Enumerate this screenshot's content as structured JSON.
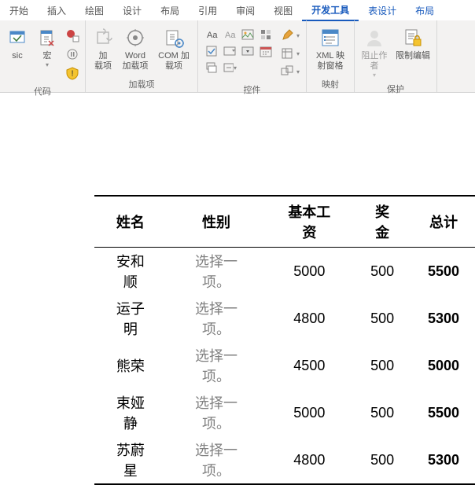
{
  "tabs": {
    "start": "开始",
    "insert": "插入",
    "draw": "绘图",
    "design": "设计",
    "layout": "布局",
    "ref": "引用",
    "review": "审阅",
    "view": "视图",
    "dev": "开发工具",
    "tdesign": "表设计",
    "tlayout": "布局"
  },
  "ribbon": {
    "code": {
      "basic": "sic",
      "macro": "宏",
      "label": "代码"
    },
    "addins": {
      "addin": "加\n载项",
      "word": "Word\n加载项",
      "com": "COM 加载项",
      "label": "加载项"
    },
    "controls": {
      "label": "控件"
    },
    "mapping": {
      "xml": "XML 映\n射窗格",
      "label": "映射"
    },
    "protect": {
      "block": "阻止作者",
      "restrict": "限制编辑",
      "label": "保护"
    }
  },
  "table": {
    "headers": {
      "name": "姓名",
      "gender": "性别",
      "base": "基本工资",
      "bonus": "奖金",
      "total": "总计"
    },
    "placeholder": "选择一项。",
    "rows": [
      {
        "name": "安和顺",
        "base": "5000",
        "bonus": "500",
        "total": "5500"
      },
      {
        "name": "运子明",
        "base": "4800",
        "bonus": "500",
        "total": "5300"
      },
      {
        "name": "熊荣",
        "base": "4500",
        "bonus": "500",
        "total": "5000"
      },
      {
        "name": "束娅静",
        "base": "5000",
        "bonus": "500",
        "total": "5500"
      },
      {
        "name": "苏蔚星",
        "base": "4800",
        "bonus": "500",
        "total": "5300"
      }
    ]
  }
}
